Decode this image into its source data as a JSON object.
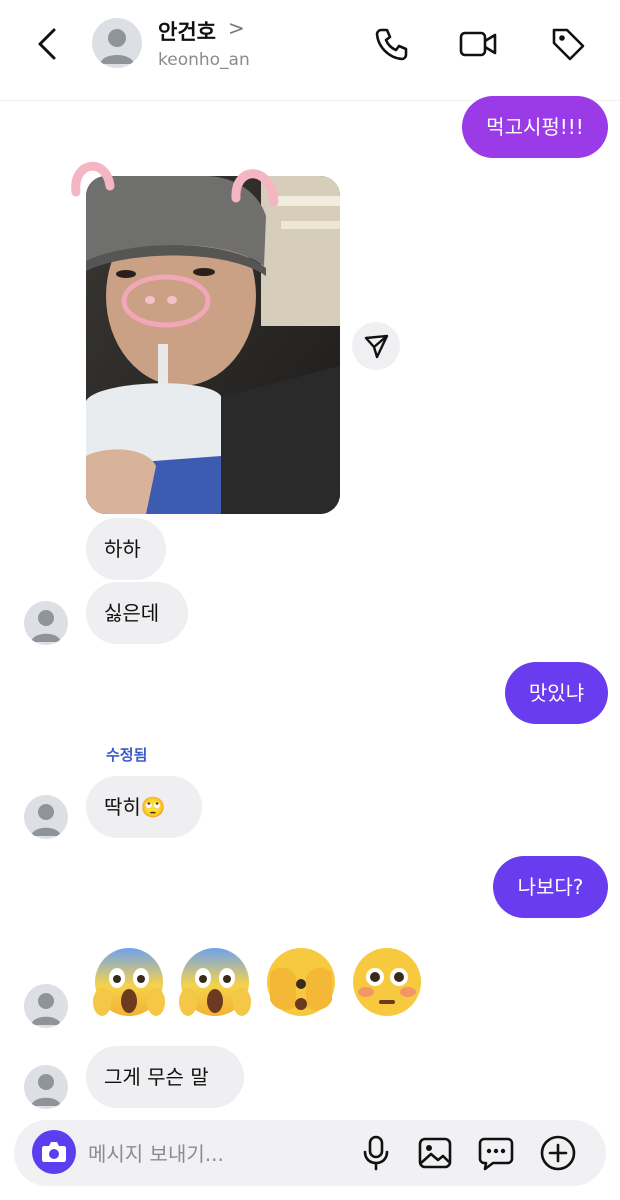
{
  "header": {
    "name": "안건호",
    "chevron": ">",
    "username": "keonho_an"
  },
  "messages": {
    "m1": "먹고시펑!!!",
    "m2": "하하",
    "m3": "싫은데",
    "m4": "맛있냐",
    "edited_label": "수정됨",
    "m5": "딱히🙄",
    "m6": "나보다?",
    "emojis": [
      "😱",
      "😱",
      "🫣",
      "😳"
    ],
    "m7": "그게 무슨 말"
  },
  "composer": {
    "placeholder": "메시지 보내기..."
  },
  "colors": {
    "outgoing_purple": "#9b3be8",
    "outgoing_violet": "#6a3cf0",
    "incoming_gray": "#efeff2",
    "camera_button": "#5b3ef0",
    "edited_blue": "#3b59c9"
  }
}
